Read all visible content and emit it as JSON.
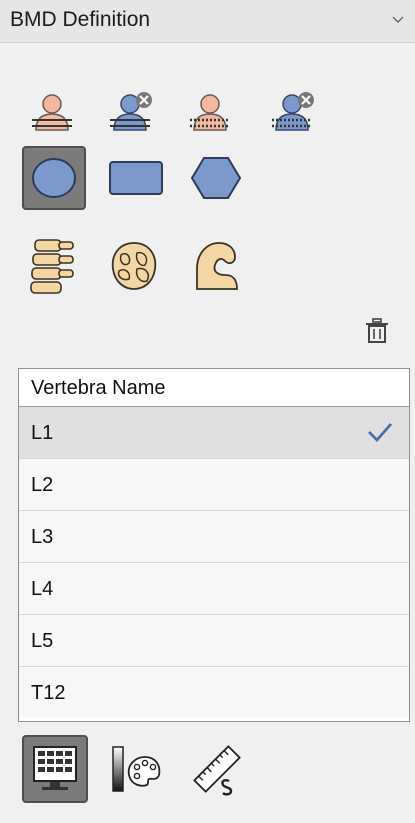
{
  "panel": {
    "title": "BMD Definition"
  },
  "tools": {
    "row1": [
      "person-pink-lines-icon",
      "person-blue-remove-lines-icon",
      "person-pink-dotted-icon",
      "person-blue-remove-dotted-icon"
    ],
    "row2": [
      "ellipse-roi-icon",
      "rectangle-roi-icon",
      "hexagon-roi-icon"
    ],
    "row3": [
      "spine-icon",
      "pelvis-icon",
      "muscle-arm-icon"
    ],
    "selected_shape": "ellipse-roi-icon"
  },
  "table": {
    "header": "Vertebra Name",
    "rows": [
      "L1",
      "L2",
      "L3",
      "L4",
      "L5",
      "T12"
    ],
    "selected": "L1"
  },
  "bottom_tools": [
    "monitor-grid-icon",
    "color-palette-icon",
    "ruler-scale-icon"
  ],
  "colors": {
    "pink": "#f2b8a0",
    "blue": "#7b9acb",
    "tan": "#f3d6a3",
    "checkmark": "#4a6fa5"
  }
}
